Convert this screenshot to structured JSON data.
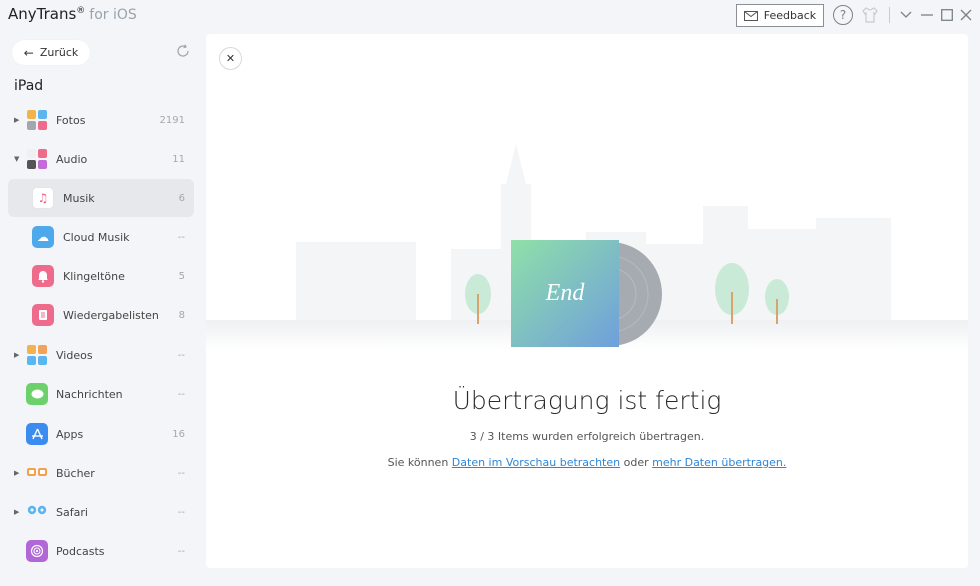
{
  "app": {
    "name": "AnyTrans",
    "reg": "®",
    "subtitle": "for iOS",
    "feedback_label": "Feedback"
  },
  "sidebar": {
    "back_label": "Zurück",
    "device": "iPad",
    "items": [
      {
        "label": "Fotos",
        "count": "2191",
        "icon": "photos-icon"
      },
      {
        "label": "Audio",
        "count": "11",
        "icon": "audio-icon"
      },
      {
        "label": "Musik",
        "count": "6",
        "icon": "music-icon"
      },
      {
        "label": "Cloud Musik",
        "count": "--",
        "icon": "cloud-music-icon"
      },
      {
        "label": "Klingeltöne",
        "count": "5",
        "icon": "ringtone-icon"
      },
      {
        "label": "Wiedergabelisten",
        "count": "8",
        "icon": "playlist-icon"
      },
      {
        "label": "Videos",
        "count": "--",
        "icon": "videos-icon"
      },
      {
        "label": "Nachrichten",
        "count": "--",
        "icon": "messages-icon"
      },
      {
        "label": "Apps",
        "count": "16",
        "icon": "apps-icon"
      },
      {
        "label": "Bücher",
        "count": "--",
        "icon": "books-icon"
      },
      {
        "label": "Safari",
        "count": "--",
        "icon": "safari-icon"
      },
      {
        "label": "Podcasts",
        "count": "--",
        "icon": "podcasts-icon"
      }
    ]
  },
  "main": {
    "album_text": "End",
    "title": "Übertragung ist fertig",
    "subtitle": "3 / 3 Items wurden erfolgreich übertragen.",
    "links_prefix": "Sie können",
    "link1": "Daten im Vorschau betrachten",
    "links_middle": "oder",
    "link2": "mehr Daten übertragen."
  },
  "colors": {
    "accent": "#2f86d6",
    "album_from": "#8fe0a8",
    "album_to": "#6f9fdc"
  }
}
